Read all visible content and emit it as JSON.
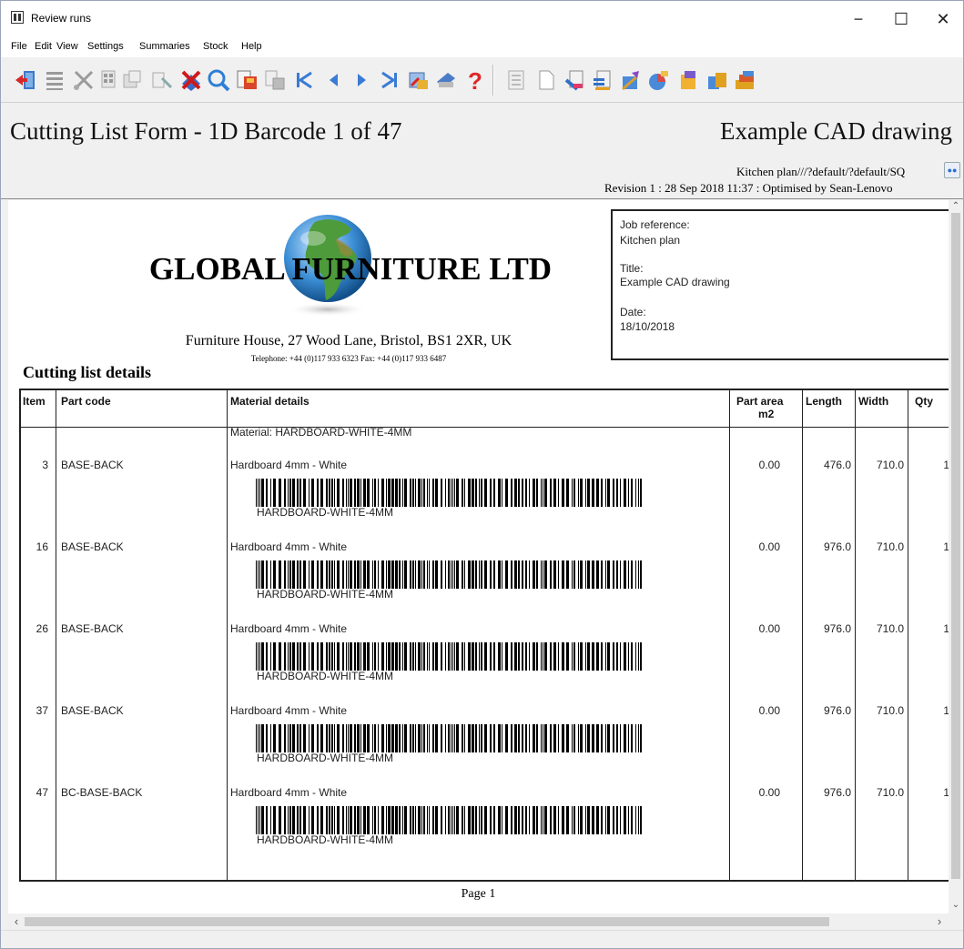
{
  "window": {
    "title": "Review runs",
    "controls": {
      "minimize": "−",
      "maximize": "☐",
      "close": "✕"
    }
  },
  "menu": [
    "File",
    "Edit",
    "View",
    "Settings",
    "Summaries",
    "Stock",
    "Help"
  ],
  "toolbar": {
    "icons": [
      "exit-icon",
      "list-icon",
      "scissors-icon",
      "grid-icon",
      "tools-icon",
      "delete-icon",
      "search-icon",
      "save-icon",
      "print-preview-icon",
      "first-page-icon",
      "previous-page-icon",
      "next-page-icon",
      "last-page-icon",
      "export-icon",
      "print-icon",
      "help-icon",
      "document-icon",
      "blank-page-icon",
      "labels-icon",
      "report-icon",
      "paint-icon",
      "chart-icon",
      "clip-icon",
      "sheets-icon",
      "stack-icon"
    ],
    "help_glyph": "?"
  },
  "report_header": {
    "form_title": "Cutting List Form - 1D Barcode 1 of 47",
    "drawing_title": "Example CAD drawing",
    "path": "Kitchen plan///?default/?default/SQ",
    "revision": "Revision 1 : 28 Sep 2018 11:37 : Optimised by Sean-Lenovo"
  },
  "company": {
    "name": "GLOBAL FURNITURE LTD",
    "address": "Furniture House, 27 Wood Lane, Bristol, BS1 2XR, UK",
    "phone": "Telephone: +44 (0)117 933 6323  Fax: +44 (0)117 933 6487"
  },
  "job": {
    "reference_label": "Job reference:",
    "reference": "Kitchen plan",
    "title_label": "Title:",
    "title": "Example CAD drawing",
    "date_label": "Date:",
    "date": "18/10/2018"
  },
  "section_heading": "Cutting list details",
  "table": {
    "headers": {
      "item": "Item",
      "part_code": "Part code",
      "material": "Material details",
      "part_area": "Part area",
      "part_area_unit": "m2",
      "length": "Length",
      "width": "Width",
      "qty": "Qty"
    },
    "material_line": "Material: HARDBOARD-WHITE-4MM",
    "rows": [
      {
        "item": "3",
        "part_code": "BASE-BACK",
        "material": "Hardboard 4mm - White",
        "barcode": "HARDBOARD-WHITE-4MM",
        "area": "0.00",
        "length": "476.0",
        "width": "710.0",
        "qty": "1"
      },
      {
        "item": "16",
        "part_code": "BASE-BACK",
        "material": "Hardboard 4mm - White",
        "barcode": "HARDBOARD-WHITE-4MM",
        "area": "0.00",
        "length": "976.0",
        "width": "710.0",
        "qty": "1"
      },
      {
        "item": "26",
        "part_code": "BASE-BACK",
        "material": "Hardboard 4mm - White",
        "barcode": "HARDBOARD-WHITE-4MM",
        "area": "0.00",
        "length": "976.0",
        "width": "710.0",
        "qty": "1"
      },
      {
        "item": "37",
        "part_code": "BASE-BACK",
        "material": "Hardboard 4mm - White",
        "barcode": "HARDBOARD-WHITE-4MM",
        "area": "0.00",
        "length": "976.0",
        "width": "710.0",
        "qty": "1"
      },
      {
        "item": "47",
        "part_code": "BC-BASE-BACK",
        "material": "Hardboard 4mm - White",
        "barcode": "HARDBOARD-WHITE-4MM",
        "area": "0.00",
        "length": "976.0",
        "width": "710.0",
        "qty": "1"
      }
    ]
  },
  "footer": {
    "page": "Page 1"
  },
  "scroll": {
    "left_arrow": "‹",
    "right_arrow": "›",
    "up_arrow": "⌃",
    "down_arrow": "⌄"
  },
  "colors": {
    "globe_sea": "#3d8fd6",
    "globe_land": "#4d9b3a",
    "window_bg": "#f0f0f0"
  }
}
